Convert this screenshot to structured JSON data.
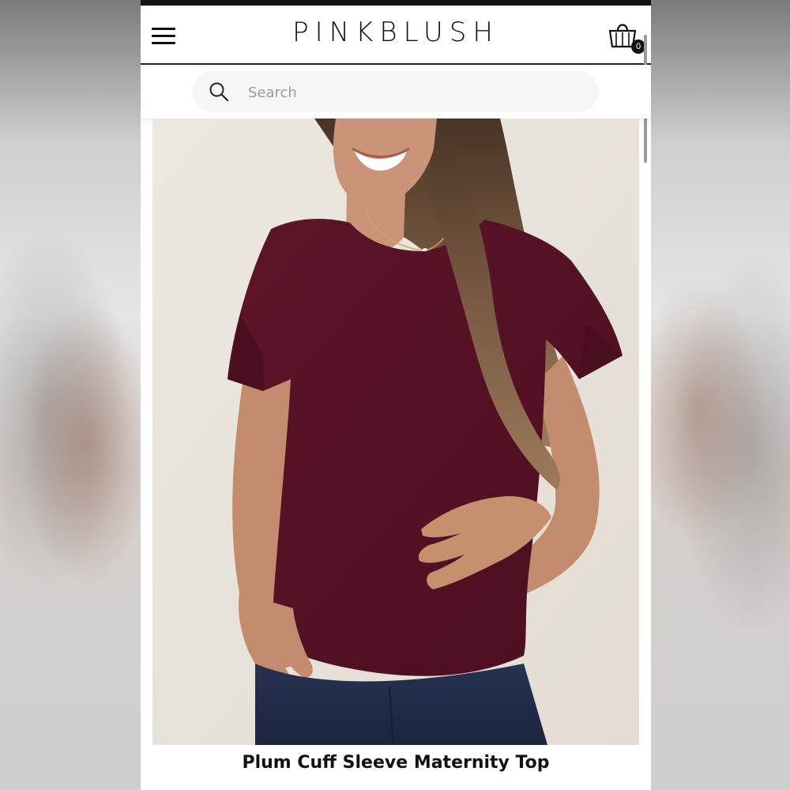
{
  "header": {
    "brand": "PINKBLUSH",
    "menu_icon": "hamburger-menu-icon",
    "cart_icon": "shopping-bag-icon",
    "cart_count": "0"
  },
  "search": {
    "placeholder": "Search",
    "value": "",
    "icon": "search-icon"
  },
  "product": {
    "title": "Plum Cuff Sleeve Maternity Top",
    "image_alt": "Plum Cuff Sleeve Maternity Top",
    "color": "#5a1226"
  },
  "colors": {
    "accent": "#111111",
    "background": "#ffffff",
    "search_bg": "#f6f6f6"
  }
}
